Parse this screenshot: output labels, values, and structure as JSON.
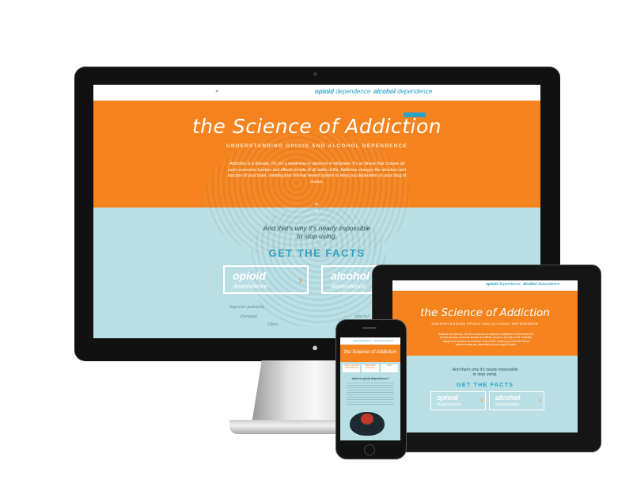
{
  "site": {
    "nav": {
      "home_icon": "circle-icon",
      "opioid_bold": "opioid",
      "opioid_rest": " dependence",
      "alcohol_bold": "alcohol",
      "alcohol_rest": " dependence"
    },
    "hero": {
      "title": "the Science of Addiction",
      "subtitle": "UNDERSTANDING OPIOID AND ALCOHOL DEPENDENCE",
      "body": "Addiction is a disease. It's not a weakness or absence of willpower. It's an illness that crosses all socio-economic borders and affects people of all walks of life. Addiction changes the structure and function of your brain, rewiring your internal reward system to keep you dependent on your drug of choice."
    },
    "tagline_line1": "And that's why it's nearly impossible",
    "tagline_line2": "to stop using.",
    "facts_heading": "GET THE FACTS",
    "buttons": [
      {
        "title": "opioid",
        "subtitle": "dependence"
      },
      {
        "title": "alcohol",
        "subtitle": "dependence"
      }
    ],
    "brain_labels": {
      "a": "Pyramid",
      "b": "Olive",
      "c": "Superior peduncle",
      "d": "Inferior"
    }
  },
  "phone": {
    "nav_left": "opioid dependence",
    "nav_right": "alcohol dependence",
    "title": "the Science of Addiction",
    "tabs": [
      "WHAT IS OPIOID DEPENDENCE",
      "TREATMENT OPTIONS",
      "HELP"
    ],
    "question": "what is opioid dependence?"
  }
}
